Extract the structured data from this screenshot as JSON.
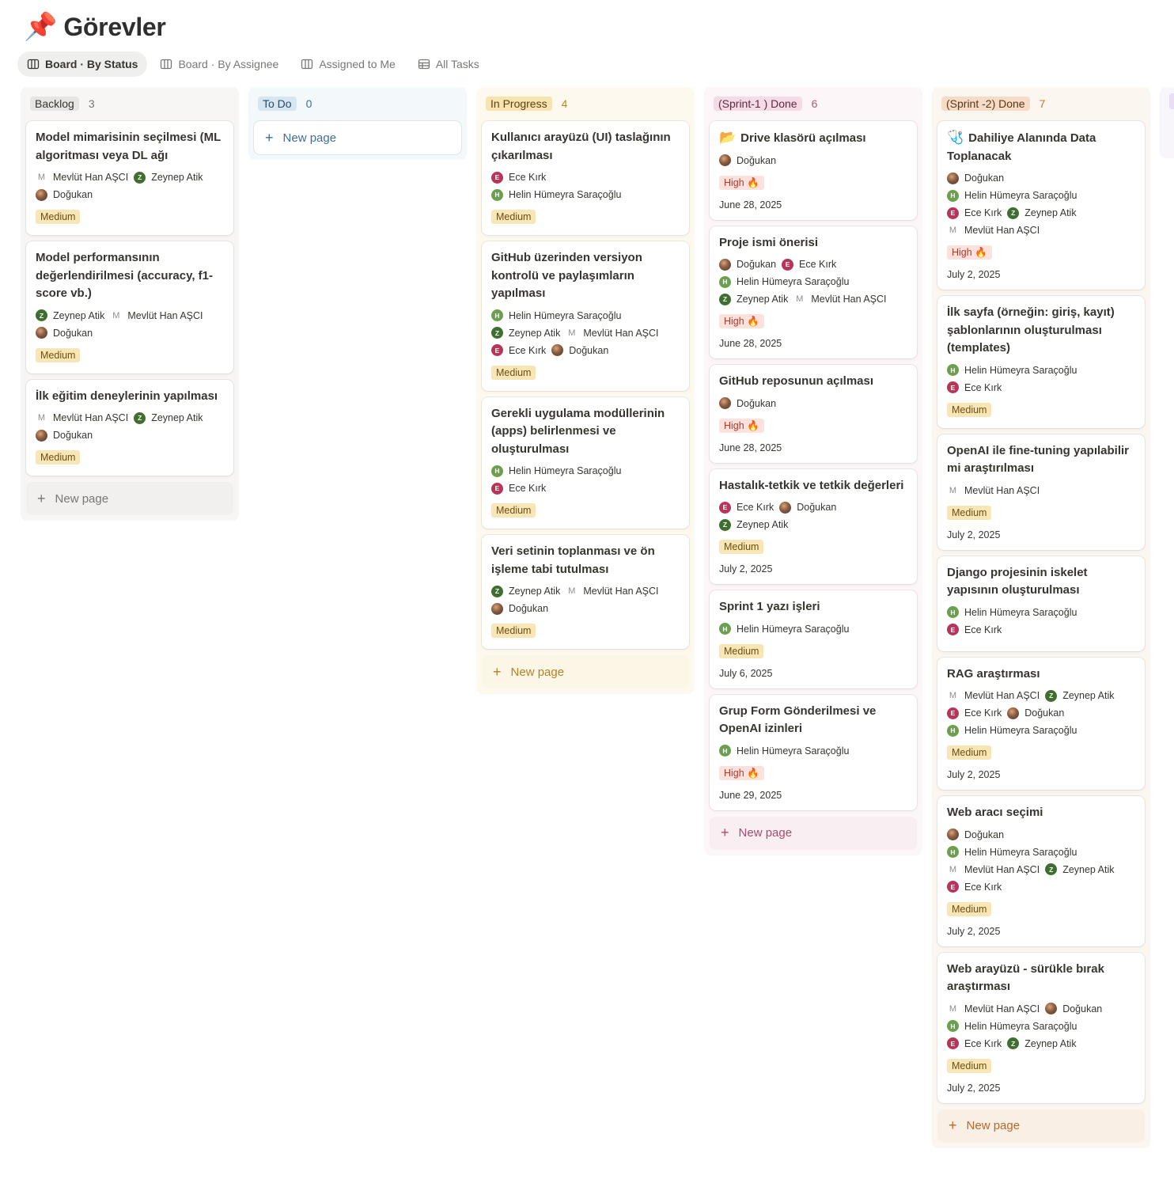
{
  "page": {
    "icon": "pushpin-icon",
    "icon_glyph": "📌",
    "title": "Görevler"
  },
  "tabs": [
    {
      "label": "Board · By Status",
      "icon": "board-icon",
      "active": true
    },
    {
      "label": "Board · By Assignee",
      "icon": "board-icon",
      "active": false
    },
    {
      "label": "Assigned to Me",
      "icon": "board-icon",
      "active": false
    },
    {
      "label": "All Tasks",
      "icon": "table-icon",
      "active": false
    }
  ],
  "new_page_label": "New page",
  "columns": [
    {
      "label": "Backlog",
      "count": "3",
      "colors": {
        "bg": "#f7f6f4",
        "pill": "#e6e5e3",
        "text": "#37352f",
        "count": "#787774",
        "new": "#f1f0ee",
        "new_text": "#787774"
      },
      "cards": [
        {
          "title": "Model mimarisinin seçilmesi (ML algoritması veya DL ağı",
          "people": [
            [
              "m",
              "Mevlüt Han AŞCI"
            ],
            [
              "z",
              "Zeynep Atik"
            ],
            [
              "d",
              "Doğukan"
            ]
          ],
          "priority": "Medium",
          "date": ""
        },
        {
          "title": " Model performansının değerlendirilmesi (accuracy, f1-score vb.)",
          "people": [
            [
              "z",
              "Zeynep Atik"
            ],
            [
              "m",
              "Mevlüt Han AŞCI"
            ],
            [
              "d",
              "Doğukan"
            ]
          ],
          "priority": "Medium",
          "date": ""
        },
        {
          "title": " İlk eğitim deneylerinin yapılması",
          "people": [
            [
              "m",
              "Mevlüt Han AŞCI"
            ],
            [
              "z",
              "Zeynep Atik"
            ],
            [
              "d",
              "Doğukan"
            ]
          ],
          "priority": "Medium",
          "date": ""
        }
      ]
    },
    {
      "label": "To Do",
      "count": "0",
      "colors": {
        "bg": "#f3f8fb",
        "pill": "#d8e6f1",
        "text": "#254b6b",
        "count": "#3f6f96",
        "new": "#ffffff",
        "new_text": "#3f6f96"
      },
      "cards": []
    },
    {
      "label": "In Progress",
      "count": "4",
      "colors": {
        "bg": "#fdf9ef",
        "pill": "#f6e3b0",
        "text": "#5b4210",
        "count": "#b98a2a",
        "new": "#fcf6e6",
        "new_text": "#b08227"
      },
      "cards": [
        {
          "title": "Kullanıcı arayüzü (UI) taslağının çıkarılması",
          "people": [
            [
              "e",
              "Ece Kırk"
            ],
            [
              "h",
              "Helin Hümeyra Saraçoğlu"
            ]
          ],
          "priority": "Medium",
          "date": ""
        },
        {
          "title": " GitHub üzerinden versiyon kontrolü ve paylaşımların yapılması",
          "people": [
            [
              "h",
              "Helin Hümeyra Saraçoğlu"
            ],
            [
              "z",
              "Zeynep Atik"
            ],
            [
              "m",
              "Mevlüt Han AŞCI"
            ],
            [
              "e",
              "Ece Kırk"
            ],
            [
              "d",
              "Doğukan"
            ]
          ],
          "priority": "Medium",
          "date": ""
        },
        {
          "title": "Gerekli uygulama modüllerinin (apps) belirlenmesi ve oluşturulması",
          "people": [
            [
              "h",
              "Helin Hümeyra Saraçoğlu"
            ],
            [
              "e",
              "Ece Kırk"
            ]
          ],
          "priority": "Medium",
          "date": ""
        },
        {
          "title": " Veri setinin toplanması ve ön işleme tabi tutulması",
          "people": [
            [
              "z",
              "Zeynep Atik"
            ],
            [
              "m",
              "Mevlüt Han AŞCI"
            ],
            [
              "d",
              "Doğukan"
            ]
          ],
          "priority": "Medium",
          "date": ""
        }
      ]
    },
    {
      "label": "(Sprint-1 ) Done",
      "count": "6",
      "colors": {
        "bg": "#fcf6f8",
        "pill": "#f5dbe5",
        "text": "#5f2a3e",
        "count": "#b0557a",
        "new": "#f9eef2",
        "new_text": "#a44d70"
      },
      "cards": [
        {
          "title": "Drive klasörü açılması",
          "title_icon": "📂",
          "title_icon_name": "folder-icon",
          "people": [
            [
              "d",
              "Doğukan"
            ]
          ],
          "priority": "High 🔥",
          "date": "June 28, 2025"
        },
        {
          "title": "Proje ismi önerisi",
          "people": [
            [
              "d",
              "Doğukan"
            ],
            [
              "e",
              "Ece Kırk"
            ],
            [
              "h",
              "Helin Hümeyra Saraçoğlu"
            ],
            [
              "z",
              "Zeynep Atik"
            ],
            [
              "m",
              "Mevlüt Han AŞCI"
            ]
          ],
          "priority": "High 🔥",
          "date": "June 28, 2025"
        },
        {
          "title": "GitHub reposunun açılması",
          "people": [
            [
              "d",
              "Doğukan"
            ]
          ],
          "priority": "High 🔥",
          "date": "June 28, 2025"
        },
        {
          "title": "Hastalık-tetkik ve tetkik değerleri",
          "people": [
            [
              "e",
              "Ece Kırk"
            ],
            [
              "d",
              "Doğukan"
            ],
            [
              "z",
              "Zeynep Atik"
            ]
          ],
          "priority": "Medium",
          "date": "July 2, 2025"
        },
        {
          "title": "Sprint 1 yazı işleri",
          "people": [
            [
              "h",
              "Helin Hümeyra Saraçoğlu"
            ]
          ],
          "priority": "Medium",
          "date": "July 6, 2025"
        },
        {
          "title": "Grup Form Gönderilmesi ve OpenAI izinleri",
          "people": [
            [
              "h",
              "Helin Hümeyra Saraçoğlu"
            ]
          ],
          "priority": "High 🔥",
          "date": "June 29, 2025"
        }
      ]
    },
    {
      "label": "(Sprint -2) Done",
      "count": "7",
      "colors": {
        "bg": "#fcf6f1",
        "pill": "#f6dcc6",
        "text": "#5d3518",
        "count": "#c2762f",
        "new": "#faefe5",
        "new_text": "#b8692a"
      },
      "cards": [
        {
          "title": "Dahiliye Alanında Data Toplanacak",
          "title_icon": "🩺",
          "title_icon_name": "stethoscope-icon",
          "people": [
            [
              "d",
              "Doğukan"
            ],
            [
              "h",
              "Helin Hümeyra Saraçoğlu"
            ],
            [
              "e",
              "Ece Kırk"
            ],
            [
              "z",
              "Zeynep Atik"
            ],
            [
              "m",
              "Mevlüt Han AŞCI"
            ]
          ],
          "priority": "High 🔥",
          "date": "July 2, 2025"
        },
        {
          "title": "İlk sayfa (örneğin: giriş, kayıt) şablonlarının oluşturulması (templates)",
          "people": [
            [
              "h",
              "Helin Hümeyra Saraçoğlu"
            ],
            [
              "e",
              "Ece Kırk"
            ]
          ],
          "priority": "Medium",
          "date": ""
        },
        {
          "title": "OpenAI ile fine-tuning yapılabilir mi araştırılması",
          "people": [
            [
              "m",
              "Mevlüt Han AŞCI"
            ]
          ],
          "priority": "Medium",
          "date": "July 2, 2025"
        },
        {
          "title": "Django projesinin iskelet yapısının oluşturulması",
          "people": [
            [
              "h",
              "Helin Hümeyra Saraçoğlu"
            ],
            [
              "e",
              "Ece Kırk"
            ]
          ],
          "priority": "",
          "date": ""
        },
        {
          "title": "RAG araştırması",
          "people": [
            [
              "m",
              "Mevlüt Han AŞCI"
            ],
            [
              "z",
              "Zeynep Atik"
            ],
            [
              "e",
              "Ece Kırk"
            ],
            [
              "d",
              "Doğukan"
            ],
            [
              "h",
              "Helin Hümeyra Saraçoğlu"
            ]
          ],
          "priority": "Medium",
          "date": "July 2, 2025"
        },
        {
          "title": "Web aracı seçimi",
          "people": [
            [
              "d",
              "Doğukan"
            ],
            [
              "h",
              "Helin Hümeyra Saraçoğlu"
            ],
            [
              "m",
              "Mevlüt Han AŞCI"
            ],
            [
              "z",
              "Zeynep Atik"
            ],
            [
              "e",
              "Ece Kırk"
            ]
          ],
          "priority": "Medium",
          "date": "July 2, 2025"
        },
        {
          "title": "Web arayüzü - sürükle bırak araştırması",
          "people": [
            [
              "m",
              "Mevlüt Han AŞCI"
            ],
            [
              "d",
              "Doğukan"
            ],
            [
              "h",
              "Helin Hümeyra Saraçoğlu"
            ],
            [
              "e",
              "Ece Kırk"
            ],
            [
              "z",
              "Zeynep Atik"
            ]
          ],
          "priority": "Medium",
          "date": "July 2, 2025"
        }
      ]
    }
  ],
  "partial_column": {
    "colors": {
      "bg": "#f8f5fb",
      "pill": "#e9def3"
    }
  }
}
